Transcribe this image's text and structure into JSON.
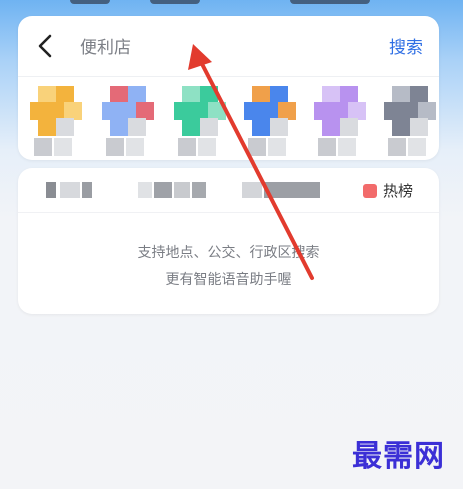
{
  "search": {
    "placeholder": "便利店",
    "button_label": "搜索"
  },
  "categories": [
    {
      "color": "#f3b33d",
      "accent": "#f9d27a"
    },
    {
      "color": "#8fb2f4",
      "accent": "#e46a77"
    },
    {
      "color": "#3bcb9c",
      "accent": "#8ee1c4"
    },
    {
      "color": "#4a86ec",
      "accent": "#f0a04a"
    },
    {
      "color": "#b892ef",
      "accent": "#d7c2f6"
    },
    {
      "color": "#7e8494",
      "accent": "#b6bbc6"
    }
  ],
  "hot": {
    "badge_label": "热榜",
    "badge_color": "#f26b6b"
  },
  "hints": {
    "line1": "支持地点、公交、行政区搜索",
    "line2": "更有智能语音助手喔"
  },
  "colors": {
    "accent": "#2f6fe4",
    "annotation": "#e23b2e"
  },
  "watermark": "最需网"
}
